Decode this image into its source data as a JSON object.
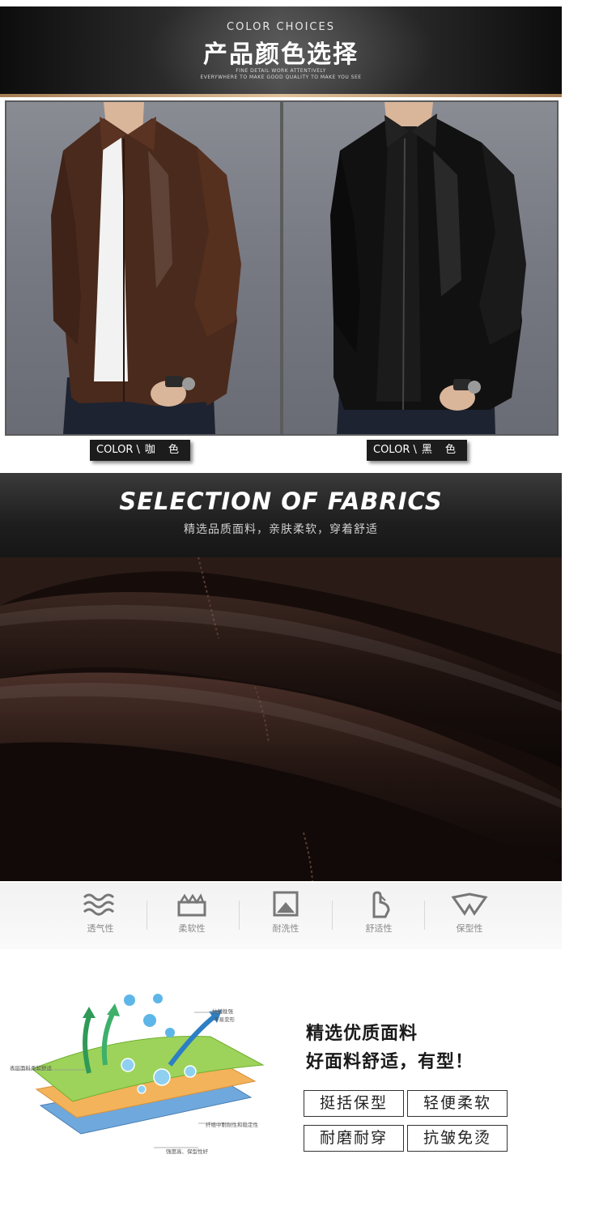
{
  "banner": {
    "eyebrow": "COLOR CHOICES",
    "title": "产品颜色选择",
    "subtitle_1": "FINE DETAIL WORK ATTENTIVELY",
    "subtitle_2": "EVERYWHERE TO MAKE GOOD QUALITY TO MAKE YOU SEE"
  },
  "colors": [
    {
      "tag_prefix": "COLOR \\",
      "name": "咖 色",
      "swatch": "#4a2a1c"
    },
    {
      "tag_prefix": "COLOR \\",
      "name": "黑 色",
      "swatch": "#121212"
    }
  ],
  "fabric": {
    "title": "SELECTION OF FABRICS",
    "subtitle": "精选品质面料，亲肤柔软，穿着舒适"
  },
  "features": [
    {
      "icon": "waves-icon",
      "label": "透气性"
    },
    {
      "icon": "cushion-icon",
      "label": "柔软性"
    },
    {
      "icon": "frame-icon",
      "label": "耐洗性"
    },
    {
      "icon": "hand-icon",
      "label": "舒适性"
    },
    {
      "icon": "collar-icon",
      "label": "保型性"
    }
  ],
  "diagram": {
    "label_top": "抗皱性强",
    "label_top_2": "不易变形",
    "label_left": "表层面料柔软舒适",
    "label_mid": "纤维中耐耐性和稳定性",
    "label_bottom": "强度高、保型性好"
  },
  "benefits": {
    "title_1": "精选优质面料",
    "title_2": "好面料舒适，有型！",
    "boxes": [
      "挺括保型",
      "轻便柔软",
      "耐磨耐穿",
      "抗皱免烫"
    ]
  }
}
